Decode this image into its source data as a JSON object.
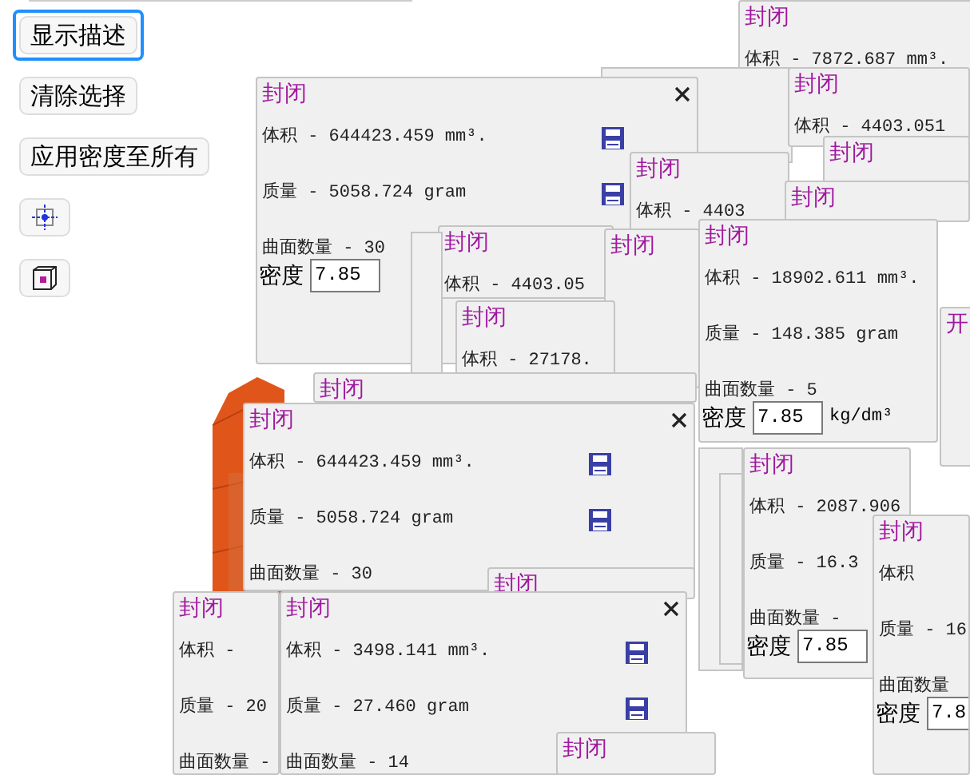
{
  "toolbar": [
    {
      "kind": "text",
      "label": "显示描述",
      "focused": true
    },
    {
      "kind": "text",
      "label": "清除选择",
      "focused": false
    },
    {
      "kind": "text",
      "label": "应用密度至所有",
      "focused": false
    },
    {
      "kind": "target",
      "focused": false
    },
    {
      "kind": "cube",
      "focused": false
    }
  ],
  "panels": [
    {
      "title": "封闭",
      "lines": [
        {
          "text": "体积 - 7872.687 mm³."
        }
      ]
    },
    {
      "title": "封闭",
      "lines": [
        {
          "text": "体积 - 4403.051"
        }
      ]
    },
    {
      "title": "封闭",
      "lines": [
        {
          "text": "体积 - 644423.459 mm³.",
          "save": true
        },
        {
          "text": "质量 - 5058.724 gram",
          "save": true
        },
        {
          "text": "曲面数量 - 30"
        }
      ],
      "density": {
        "label": "密度",
        "value": "7.85"
      },
      "close": true
    },
    {
      "title": "封闭",
      "lines": [
        {
          "text": "体积 - 4403"
        }
      ]
    },
    {
      "title": "封闭"
    },
    {
      "title": "封闭"
    },
    {
      "title": "封闭",
      "lines": [
        {
          "text": "体积 - 4403.05"
        }
      ]
    },
    {
      "title": "封闭"
    },
    {
      "title": "封闭",
      "lines": [
        {
          "text": "体积 - 27178."
        }
      ]
    },
    {
      "title": "封闭",
      "lines": [
        {
          "text": "体积 - 18902.611 mm³."
        },
        {
          "text": "质量 - 148.385 gram"
        },
        {
          "text": "曲面数量 - 5"
        }
      ],
      "density": {
        "label": "密度",
        "value": "7.85",
        "unit": "kg/dm³"
      }
    },
    {
      "title": "开"
    },
    {
      "title": "封闭"
    },
    {
      "title": "封闭",
      "lines": [
        {
          "text": "体积 - 644423.459 mm³.",
          "save": true
        },
        {
          "text": "质量 - 5058.724 gram",
          "save": true
        },
        {
          "text": "曲面数量 - 30"
        }
      ],
      "close": true
    },
    {
      "title": "封闭"
    },
    {
      "title": "封闭",
      "lines": [
        {
          "text": "体积 - 2087.906"
        },
        {
          "text": "质量 - 16.3"
        },
        {
          "text": "曲面数量 -"
        }
      ],
      "density": {
        "label": "密度",
        "value": "7.85"
      }
    },
    {
      "title": "封闭",
      "lines": [
        {
          "text": "体积"
        },
        {
          "text": "质量 - 16"
        },
        {
          "text": "曲面数量"
        }
      ],
      "density": {
        "label": "密度",
        "value": "7.8"
      }
    },
    {
      "title": "封闭",
      "lines": [
        {
          "text": "体积 -"
        },
        {
          "text": "质量 - 20"
        },
        {
          "text": "曲面数量 -"
        }
      ]
    },
    {
      "title": "封闭",
      "lines": [
        {
          "text": "体积 - 3498.141 mm³.",
          "save": true
        },
        {
          "text": "质量 - 27.460 gram",
          "save": true
        },
        {
          "text": "曲面数量 - 14"
        }
      ],
      "close": true
    },
    {
      "title": "封闭"
    }
  ]
}
